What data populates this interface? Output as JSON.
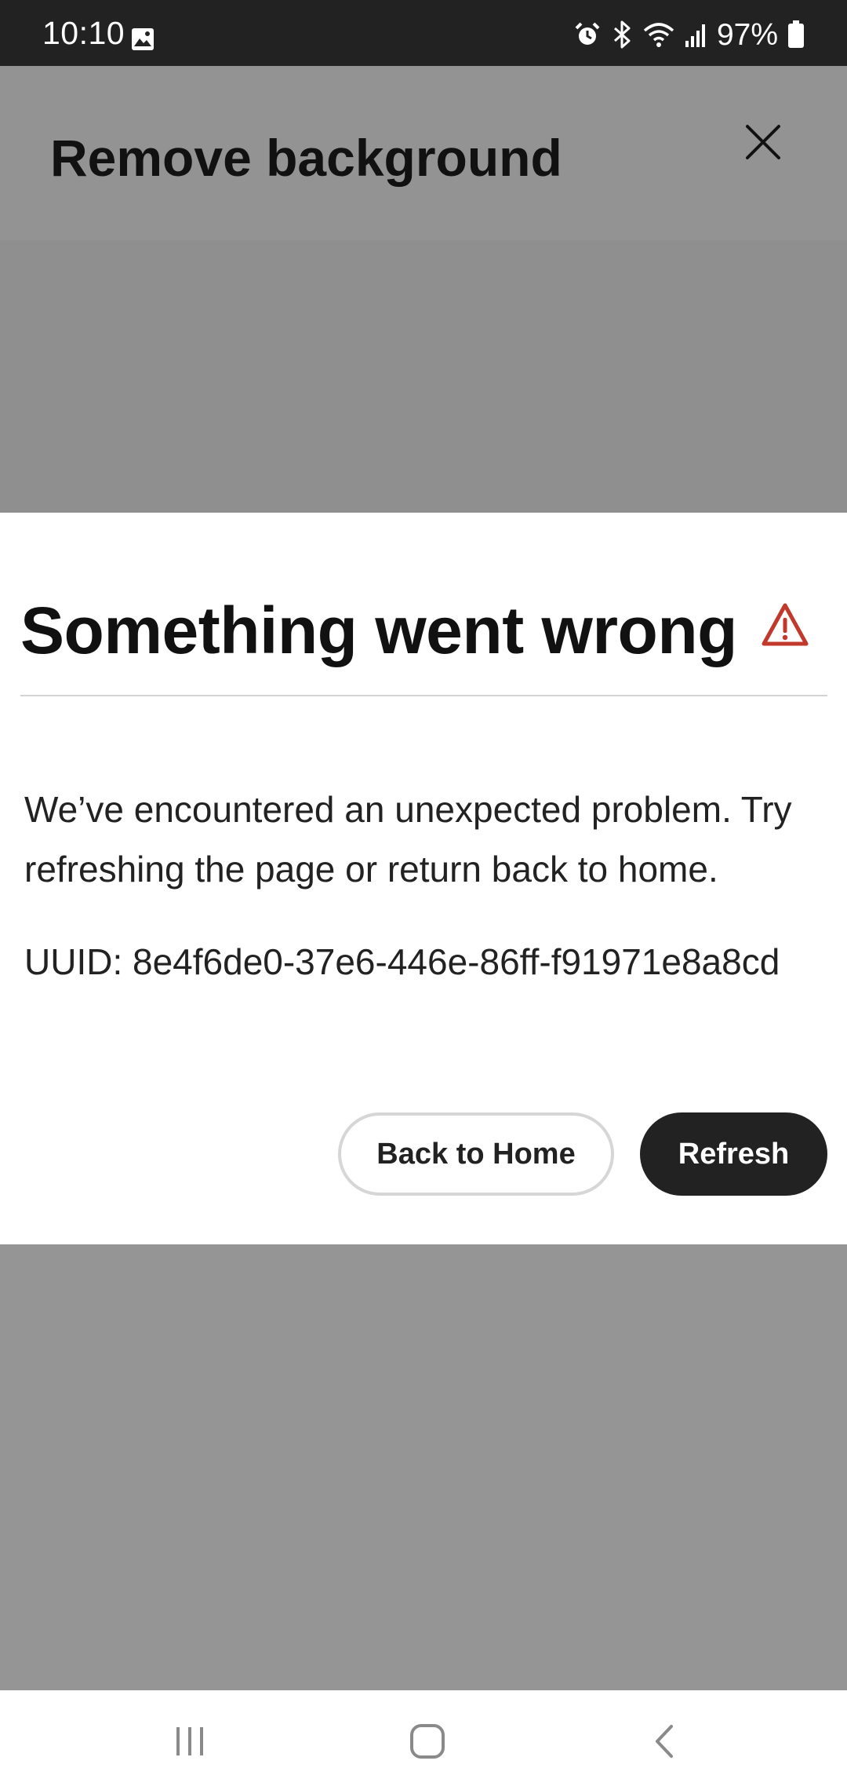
{
  "status_bar": {
    "time": "10:10",
    "battery": "97%",
    "icons": [
      "gallery-icon",
      "alarm-icon",
      "bluetooth-icon",
      "wifi-icon",
      "signal-icon",
      "battery-icon"
    ]
  },
  "header": {
    "title": "Remove background",
    "close_icon": "close-icon"
  },
  "dialog": {
    "title": "Something went wrong",
    "warning_icon": "warning-icon",
    "warning_color": "#c0392b",
    "message": "We’ve encountered an unexpected problem. Try refreshing the page or return back to home.",
    "uuid": "UUID: 8e4f6de0-37e6-446e-86ff-f91971e8a8cd",
    "back_to_home_label": "Back to Home",
    "refresh_label": "Refresh"
  },
  "nav_bar": {
    "items": [
      "recents-icon",
      "home-icon",
      "back-icon"
    ]
  },
  "colors": {
    "status_bar_bg": "#222222",
    "overlay_bg": "#959595",
    "primary_button_bg": "#222222",
    "warning": "#c0392b"
  }
}
